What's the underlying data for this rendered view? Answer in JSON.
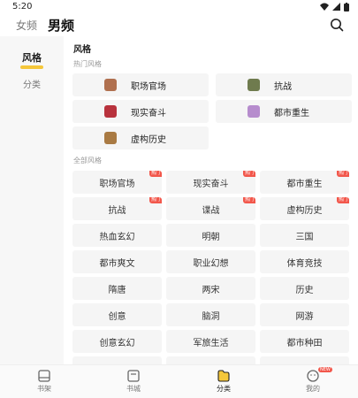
{
  "status_bar": {
    "time": "5:20"
  },
  "header": {
    "tabs": [
      "女频",
      "男频"
    ],
    "active_tab": "男频"
  },
  "sidebar": {
    "items": [
      "风格",
      "分类"
    ],
    "active": "风格"
  },
  "section": {
    "title": "风格",
    "hot_title": "热门风格",
    "all_title": "全部风格",
    "hot_badge": "热门",
    "hot_items": [
      "职场官场",
      "抗战",
      "现实奋斗",
      "都市重生",
      "虚构历史"
    ],
    "all_items": [
      "职场官场",
      "现实奋斗",
      "都市重生",
      "抗战",
      "谍战",
      "虚构历史",
      "热血玄幻",
      "明朝",
      "三国",
      "都市爽文",
      "职业幻想",
      "体育竞技",
      "隋唐",
      "两宋",
      "历史",
      "创意",
      "脑洞",
      "网游",
      "创意玄幻",
      "军旅生活",
      "都市种田",
      "",
      "",
      ""
    ],
    "hot_flags": [
      true,
      true,
      true,
      true,
      true,
      true
    ]
  },
  "bottom_nav": {
    "items": [
      "书架",
      "书城",
      "分类",
      "我的"
    ],
    "active": "分类",
    "new_badge": "NEW"
  },
  "colors": {
    "accent": "#f5c73a",
    "badge": "#f2574b",
    "card_bg": "#f5f5f5"
  }
}
